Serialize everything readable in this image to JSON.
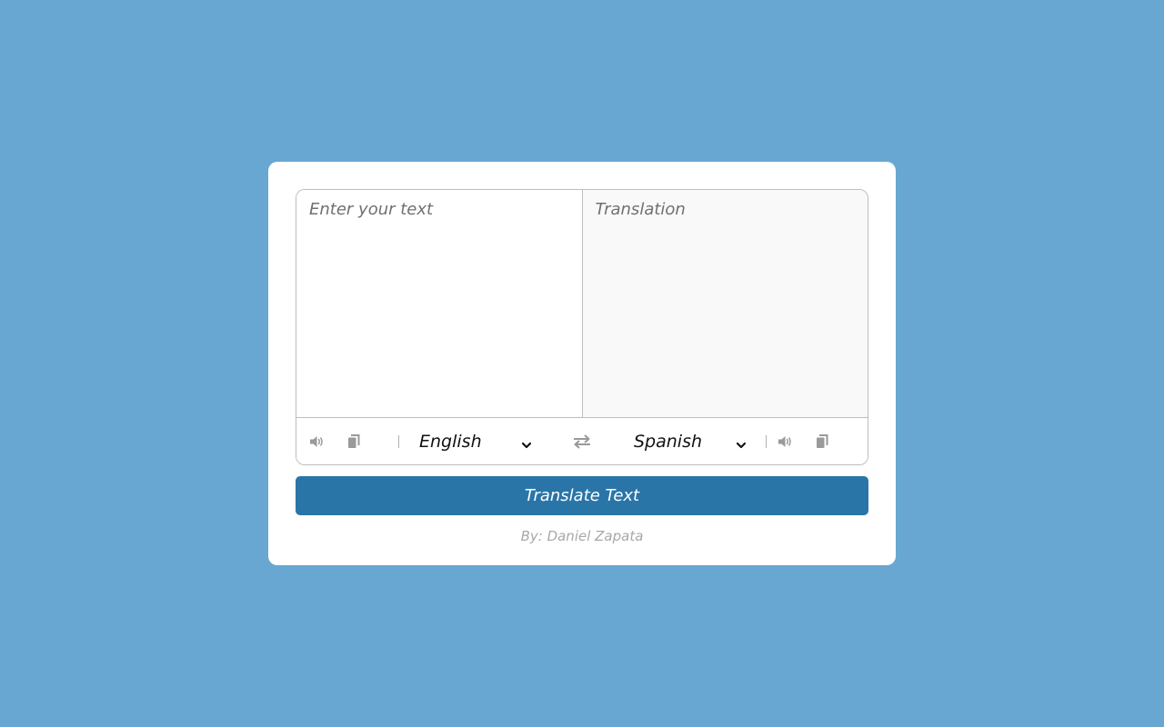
{
  "colors": {
    "background": "#67a7d2",
    "card": "#ffffff",
    "button": "#2a75a8",
    "icon": "#9a9a9a"
  },
  "source": {
    "placeholder": "Enter your text",
    "value": ""
  },
  "target": {
    "placeholder": "Translation",
    "value": ""
  },
  "languages": {
    "from": "English",
    "to": "Spanish"
  },
  "icons": {
    "speak_from": "volume-icon",
    "copy_from": "copy-icon",
    "exchange": "exchange-icon",
    "speak_to": "volume-icon",
    "copy_to": "copy-icon",
    "dropdown": "chevron-down-icon"
  },
  "button": {
    "label": "Translate Text"
  },
  "credit": "By: Daniel Zapata"
}
